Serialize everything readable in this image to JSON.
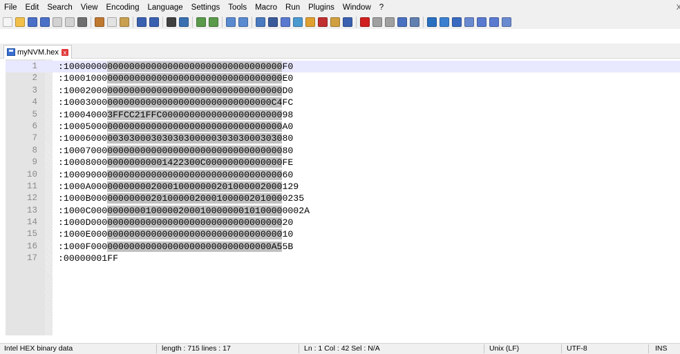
{
  "menu": {
    "items": [
      "File",
      "Edit",
      "Search",
      "View",
      "Encoding",
      "Language",
      "Settings",
      "Tools",
      "Macro",
      "Run",
      "Plugins",
      "Window",
      "?"
    ],
    "close_glyph": "X"
  },
  "toolbar": {
    "icons": [
      {
        "name": "new-file-icon",
        "color": "#f5f5f5"
      },
      {
        "name": "open-file-icon",
        "color": "#f2c04a"
      },
      {
        "name": "save-icon",
        "color": "#4a70c8"
      },
      {
        "name": "save-all-icon",
        "color": "#4a70c8"
      },
      {
        "name": "close-icon",
        "color": "#d2d2d2"
      },
      {
        "name": "close-all-icon",
        "color": "#d2d2d2"
      },
      {
        "name": "print-icon",
        "color": "#6f6f6f"
      },
      {
        "sep": true
      },
      {
        "name": "cut-icon",
        "color": "#c07830"
      },
      {
        "name": "copy-icon",
        "color": "#e2e2e2"
      },
      {
        "name": "paste-icon",
        "color": "#c8a050"
      },
      {
        "sep": true
      },
      {
        "name": "undo-icon",
        "color": "#3a60b0"
      },
      {
        "name": "redo-icon",
        "color": "#3a60b0"
      },
      {
        "sep": true
      },
      {
        "name": "find-icon",
        "color": "#404040"
      },
      {
        "name": "replace-icon",
        "color": "#3a70b0"
      },
      {
        "sep": true
      },
      {
        "name": "zoom-in-icon",
        "color": "#5a9a4a"
      },
      {
        "name": "zoom-out-icon",
        "color": "#5a9a4a"
      },
      {
        "sep": true
      },
      {
        "name": "sync-vertical-icon",
        "color": "#5a8ad0"
      },
      {
        "name": "sync-horizontal-icon",
        "color": "#5a8ad0"
      },
      {
        "sep": true
      },
      {
        "name": "word-wrap-icon",
        "color": "#4a7ac0"
      },
      {
        "name": "show-all-chars-icon",
        "color": "#3a5a9a"
      },
      {
        "name": "indent-guide-icon",
        "color": "#5a7ad0"
      },
      {
        "name": "language-icon",
        "color": "#4a9ad0"
      },
      {
        "name": "doc-map-icon",
        "color": "#e0a030"
      },
      {
        "name": "function-list-icon",
        "color": "#c03030"
      },
      {
        "name": "folder-workspace-icon",
        "color": "#d0a040"
      },
      {
        "name": "monitoring-icon",
        "color": "#3a60b0"
      },
      {
        "sep": true
      },
      {
        "name": "record-macro-icon",
        "color": "#d02020"
      },
      {
        "name": "stop-recording-icon",
        "color": "#a0a0a0"
      },
      {
        "name": "playback-icon",
        "color": "#a0a0a0"
      },
      {
        "name": "run-macro-multiple-icon",
        "color": "#4a70c0"
      },
      {
        "name": "save-macro-icon",
        "color": "#6080b0"
      },
      {
        "sep": true
      },
      {
        "name": "hex-editor-icon",
        "color": "#2a70c0"
      },
      {
        "name": "hex-compare-icon",
        "color": "#3a80d0"
      },
      {
        "name": "hex-insert-icon",
        "color": "#3a6ac0"
      },
      {
        "name": "hex-left-icon",
        "color": "#6a8ad0"
      },
      {
        "name": "hex-up-icon",
        "color": "#5a7ad0"
      },
      {
        "name": "hex-down-icon",
        "color": "#5a7ad0"
      },
      {
        "name": "hex-goto-icon",
        "color": "#6a8ad0"
      }
    ]
  },
  "tab": {
    "label": "myNVM.hex",
    "close_glyph": "x"
  },
  "editor": {
    "lines": [
      {
        "n": "1",
        "pre": ":10000000",
        "mid": "00000000000000000000000000000000",
        "post": "F0"
      },
      {
        "n": "2",
        "pre": ":10001000",
        "mid": "00000000000000000000000000000000",
        "post": "E0"
      },
      {
        "n": "3",
        "pre": ":10002000",
        "mid": "00000000000000000000000000000000",
        "post": "D0"
      },
      {
        "n": "4",
        "pre": ":10003000",
        "mid": "000000000000000000000000000000C4",
        "post": "FC"
      },
      {
        "n": "5",
        "pre": ":10004000",
        "mid": "3FFCC21FFC0000000000000000000000",
        "post": "98"
      },
      {
        "n": "6",
        "pre": ":10005000",
        "mid": "00000000000000000000000000000000",
        "post": "A0"
      },
      {
        "n": "7",
        "pre": ":10006000",
        "mid": "00303000303030300000303030003030",
        "post": "80"
      },
      {
        "n": "8",
        "pre": ":10007000",
        "mid": "00000000000000000000000000000000",
        "post": "80"
      },
      {
        "n": "9",
        "pre": ":10008000",
        "mid": "00000000001422300C00000000000000",
        "post": "FE"
      },
      {
        "n": "10",
        "pre": ":10009000",
        "mid": "00000000000000000000000000000000",
        "post": "60"
      },
      {
        "n": "11",
        "pre": ":1000A000",
        "mid": "00000000200010000000201000002000",
        "post": "129"
      },
      {
        "n": "12",
        "pre": ":1000B000",
        "mid": "00000000201000002000100000201000",
        "post": "0235"
      },
      {
        "n": "13",
        "pre": ":1000C000",
        "mid": "00000001000002000100000001010000",
        "post": "0002A"
      },
      {
        "n": "14",
        "pre": ":1000D000",
        "mid": "00000000000000000000000000000000",
        "post": "20"
      },
      {
        "n": "15",
        "pre": ":1000E000",
        "mid": "00000000000000000000000000000000",
        "post": "10"
      },
      {
        "n": "16",
        "pre": ":1000F000",
        "mid": "000000000000000000000000000000A5",
        "post": "5B"
      },
      {
        "n": "17",
        "pre": ":00000001FF",
        "mid": "",
        "post": ""
      }
    ]
  },
  "status": {
    "file_type": "Intel HEX binary data",
    "length": "length : 715    lines : 17",
    "position": "Ln : 1    Col : 42    Sel : N/A",
    "eol": "Unix (LF)",
    "encoding": "UTF-8",
    "mode": "INS"
  }
}
